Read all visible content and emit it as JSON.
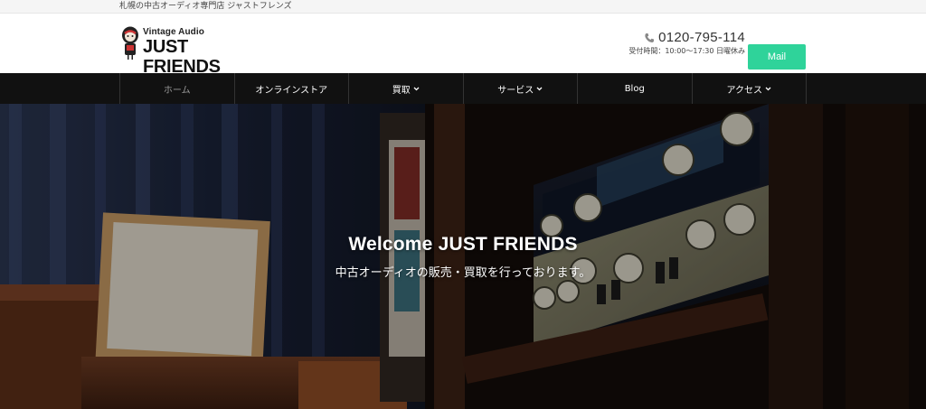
{
  "topbar": {
    "tagline": "札幌の中古オーディオ専門店 ジャストフレンズ"
  },
  "logo": {
    "small": "Vintage Audio",
    "name": "JUST FRIENDS"
  },
  "contact": {
    "phone": "0120-795-114",
    "hours": "受付時間：10:00〜17:30 日曜休み",
    "icon": "phone-icon"
  },
  "mail_button": {
    "label": "Mail",
    "color": "#2fd39a"
  },
  "nav": {
    "items": [
      {
        "label": "ホーム",
        "dropdown": false,
        "active": true
      },
      {
        "label": "オンラインストア",
        "dropdown": false,
        "active": false
      },
      {
        "label": "買取",
        "dropdown": true,
        "active": false
      },
      {
        "label": "サービス",
        "dropdown": true,
        "active": false
      },
      {
        "label": "Blog",
        "dropdown": false,
        "active": false
      },
      {
        "label": "アクセス",
        "dropdown": true,
        "active": false
      }
    ]
  },
  "hero": {
    "headline": "Welcome JUST FRIENDS",
    "subline": "中古オーディオの販売・買取を行っております。"
  }
}
